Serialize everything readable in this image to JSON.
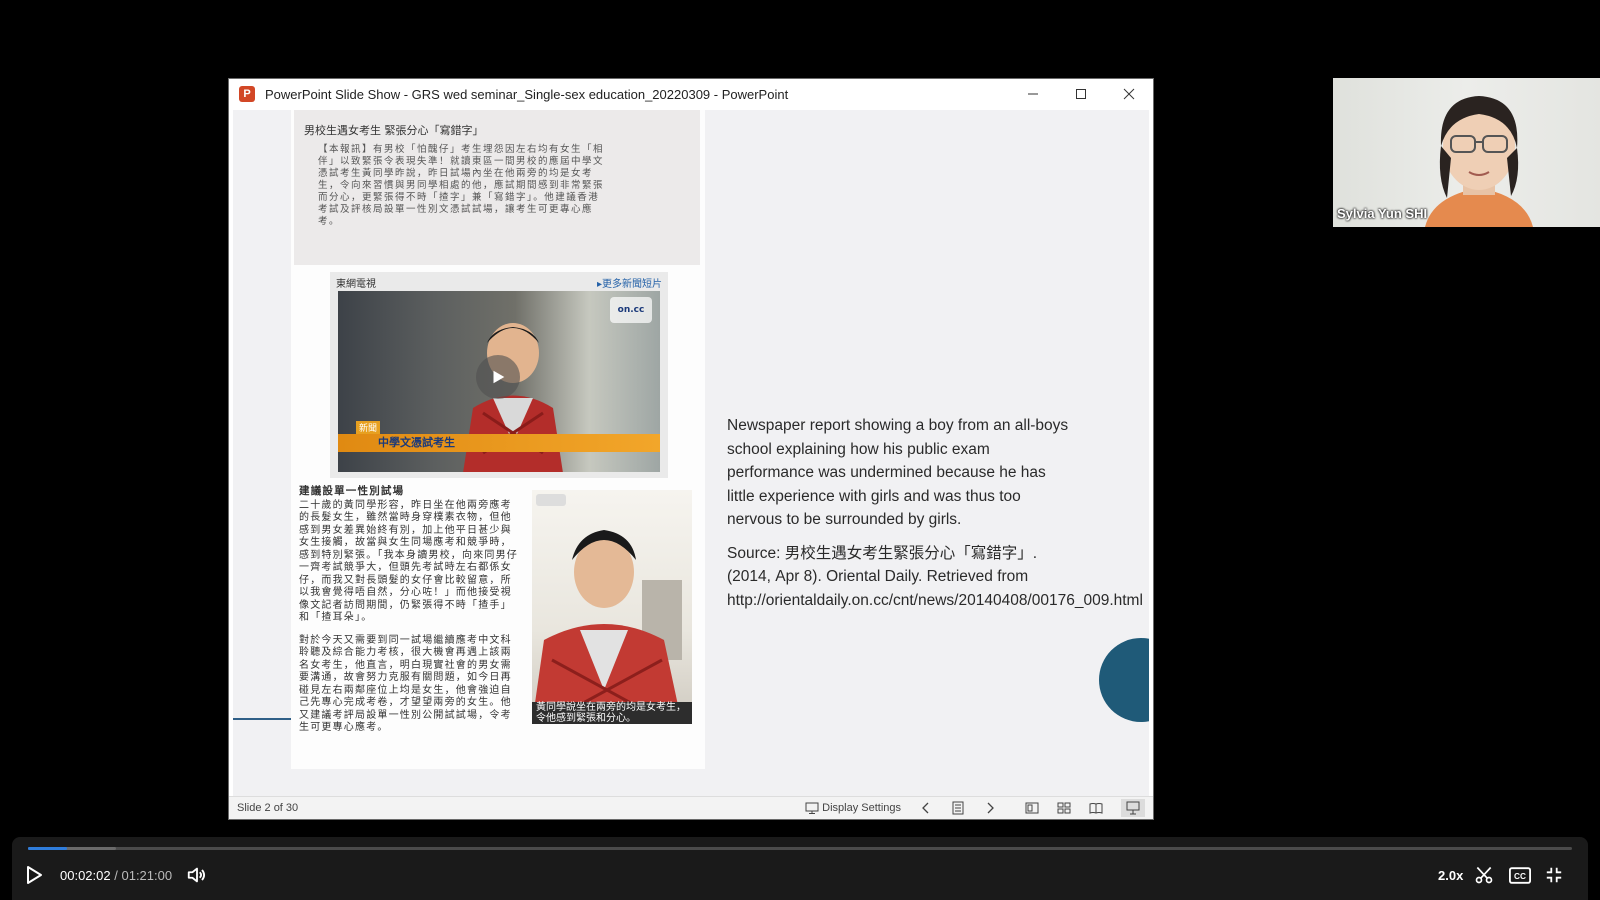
{
  "window": {
    "app_icon_letter": "P",
    "title": "PowerPoint Slide Show  -  GRS wed seminar_Single-sex education_20220309 - PowerPoint"
  },
  "clipping": {
    "headline": "男校生遇女考生 緊張分心「寫錯字」",
    "intro": "【本報訊】有男校「怕醜仔」考生埋怨因左右均有女生「相伴」以致緊張令表現失準！就讀東區一間男校的應屆中學文憑試考生黃同學昨說，昨日試場內坐在他兩旁的均是女考生，令向來習慣與男同學相處的他，應試期間感到非常緊張而分心，更緊張得不時「揸字」兼「寫錯字」。他建議香港考試及評核局設單一性別文憑試試場，讓考生可更專心應考。",
    "video_source": "東網電視",
    "video_more": "▸更多新聞短片",
    "video_logo": "on.cc",
    "video_tag": "新聞",
    "video_caption": "中學文憑試考生",
    "section_head": "建議設單一性別試場",
    "article_p1": "二十歲的黃同學形容，昨日坐在他兩旁應考的長髮女生，雖然當時身穿樸素衣物，但他感到男女差異始終有別，加上他平日甚少與女生接觸，故當與女生同場應考和競爭時，感到特別緊張。「我本身讀男校，向來同男仔一齊考試競爭大，但頭先考試時左右都係女仔，而我又對長頭髮的女仔會比較留意，所以我會覺得唔自然，分心咗！」而他接受視像文記者訪問期間，仍緊張得不時「揸手」和「揸耳朵」。",
    "article_p2": "對於今天又需要到同一試場繼續應考中文科聆聽及綜合能力考核，很大機會再遇上該兩名女考生，他直言，明白現實社會的男女需要溝通，故會努力克服有關問題，如今日再碰見左右兩鄰座位上均是女生，他會強迫自己先專心完成考卷，才望望兩旁的女生。他又建議考評局設單一性別公開試試場，令考生可更專心應考。",
    "photo_caption": "黃同學說坐在兩旁的均是女考生，令他感到緊張和分心。"
  },
  "slide_text": {
    "description": "Newspaper report showing a boy from an all-boys school explaining how his public exam performance was undermined because he has little experience with girls and was thus too nervous to be surrounded by girls.",
    "source": "Source: 男校生遇女考生緊張分心「寫錯字」. (2014, Apr 8). Oriental Daily. Retrieved from http://orientaldaily.on.cc/cnt/news/20140408/00176_009.html"
  },
  "statusbar": {
    "slide_counter": "Slide 2 of 30",
    "display_settings": "Display Settings"
  },
  "participant": {
    "name": "Sylvia Yun SHI"
  },
  "player": {
    "current_time": "00:02:02",
    "separator": "/",
    "duration": "01:21:00",
    "speed": "2.0x",
    "progress_fraction": 0.025
  },
  "colors": {
    "accent_blue": "#2f7ddc",
    "deco_circle": "#1f5a78",
    "powerpoint_red": "#d24726"
  }
}
